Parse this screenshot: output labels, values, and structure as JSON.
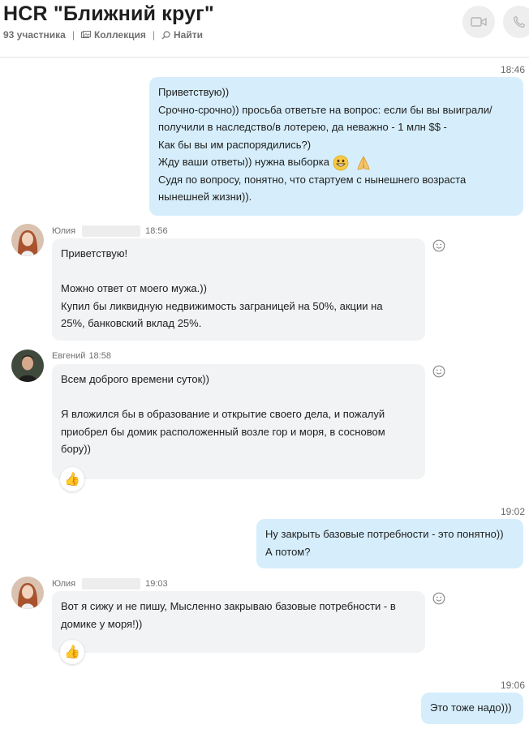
{
  "header": {
    "title": "HCR \"Ближний круг\"",
    "participants": "93 участника",
    "collection_label": "Коллекция",
    "find_label": "Найти"
  },
  "messages": [
    {
      "time": "18:46",
      "lines": [
        "Приветствую))",
        "Срочно-срочно)) просьба ответьте на вопрос: если бы вы выиграли/",
        "получили в наследство/в лотерею, да неважно - 1 млн $$ -",
        "Как бы вы им распорядились?)",
        "Жду ваши ответы)) нужна выборка",
        "Судя по вопросу, понятно, что стартуем с нынешнего возраста",
        "нынешней жизни))."
      ]
    },
    {
      "sender": "Юлия",
      "time": "18:56",
      "lines": [
        "Приветствую!",
        "",
        "Можно ответ от моего мужа.))",
        "Купил бы ликвидную недвижимость заграницей на 50%,  акции на",
        "25%, банковский вклад 25%."
      ]
    },
    {
      "sender": "Евгений",
      "time": "18:58",
      "lines": [
        "Всем доброго времени суток))",
        "",
        "Я вложился бы в образование и открытие своего дела, и пожалуй",
        "приобрел бы домик расположенный возле гор и моря, в сосновом",
        "бору))"
      ]
    },
    {
      "time": "19:02",
      "lines": [
        "Ну закрыть базовые потребности - это понятно))",
        "А потом?"
      ]
    },
    {
      "sender": "Юлия",
      "time": "19:03",
      "lines": [
        "Вот я сижу и не пишу, Мысленно закрываю базовые потребности - в",
        "домике у моря!))"
      ]
    },
    {
      "time": "19:06",
      "lines": [
        "Это тоже надо)))"
      ]
    }
  ],
  "reactions": {
    "thumbs_up": "👍"
  },
  "colors": {
    "outgoing_bubble": "#d6eefc",
    "incoming_bubble": "#f1f3f5",
    "timestamp": "#6b6b6b"
  }
}
